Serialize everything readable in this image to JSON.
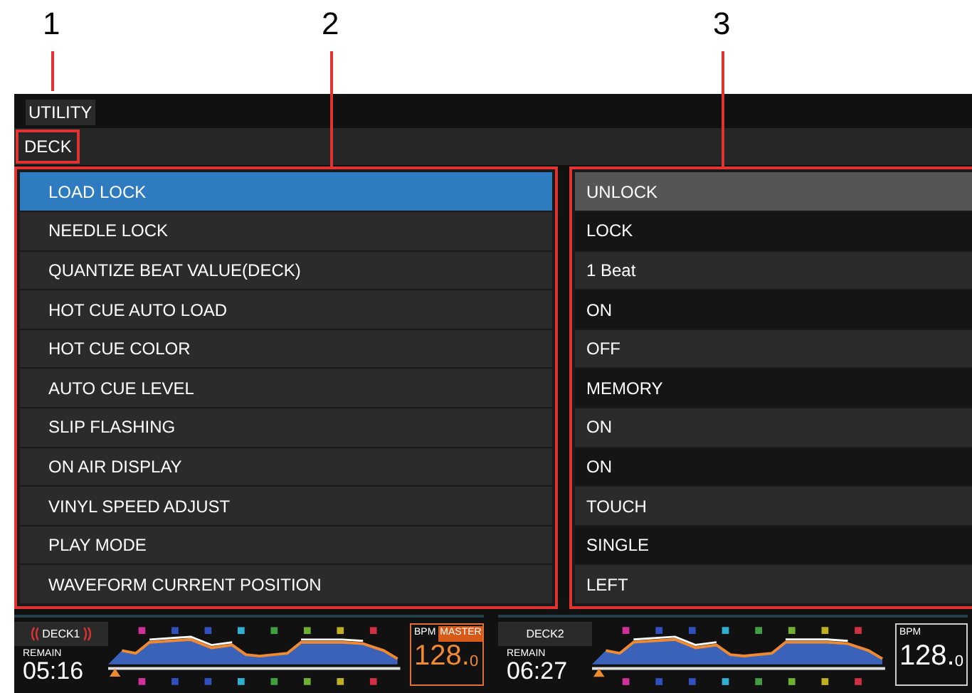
{
  "callouts": [
    "1",
    "2",
    "3"
  ],
  "header": {
    "title": "UTILITY"
  },
  "tab": {
    "label": "DECK"
  },
  "settings": [
    {
      "label": "LOAD LOCK",
      "value": "UNLOCK",
      "selected": true
    },
    {
      "label": "NEEDLE LOCK",
      "value": "LOCK",
      "selected": false
    },
    {
      "label": "QUANTIZE BEAT VALUE(DECK)",
      "value": "1 Beat",
      "selected": false
    },
    {
      "label": "HOT CUE AUTO LOAD",
      "value": "ON",
      "selected": false
    },
    {
      "label": "HOT CUE COLOR",
      "value": "OFF",
      "selected": false
    },
    {
      "label": "AUTO CUE LEVEL",
      "value": "MEMORY",
      "selected": false
    },
    {
      "label": "SLIP FLASHING",
      "value": "ON",
      "selected": false
    },
    {
      "label": "ON AIR DISPLAY",
      "value": "ON",
      "selected": false
    },
    {
      "label": "VINYL SPEED ADJUST",
      "value": "TOUCH",
      "selected": false
    },
    {
      "label": "PLAY MODE",
      "value": "SINGLE",
      "selected": false
    },
    {
      "label": "WAVEFORM CURRENT POSITION",
      "value": "LEFT",
      "selected": false
    }
  ],
  "decks": [
    {
      "label": "DECK1",
      "on_air": true,
      "remain_label": "REMAIN",
      "time": "05:16",
      "bpm_label": "BPM",
      "master": true,
      "master_label": "MASTER",
      "bpm": "128.",
      "bpm_decimal": "0"
    },
    {
      "label": "DECK2",
      "on_air": false,
      "remain_label": "REMAIN",
      "time": "06:27",
      "bpm_label": "BPM",
      "master": false,
      "bpm": "128.",
      "bpm_decimal": "0"
    }
  ]
}
